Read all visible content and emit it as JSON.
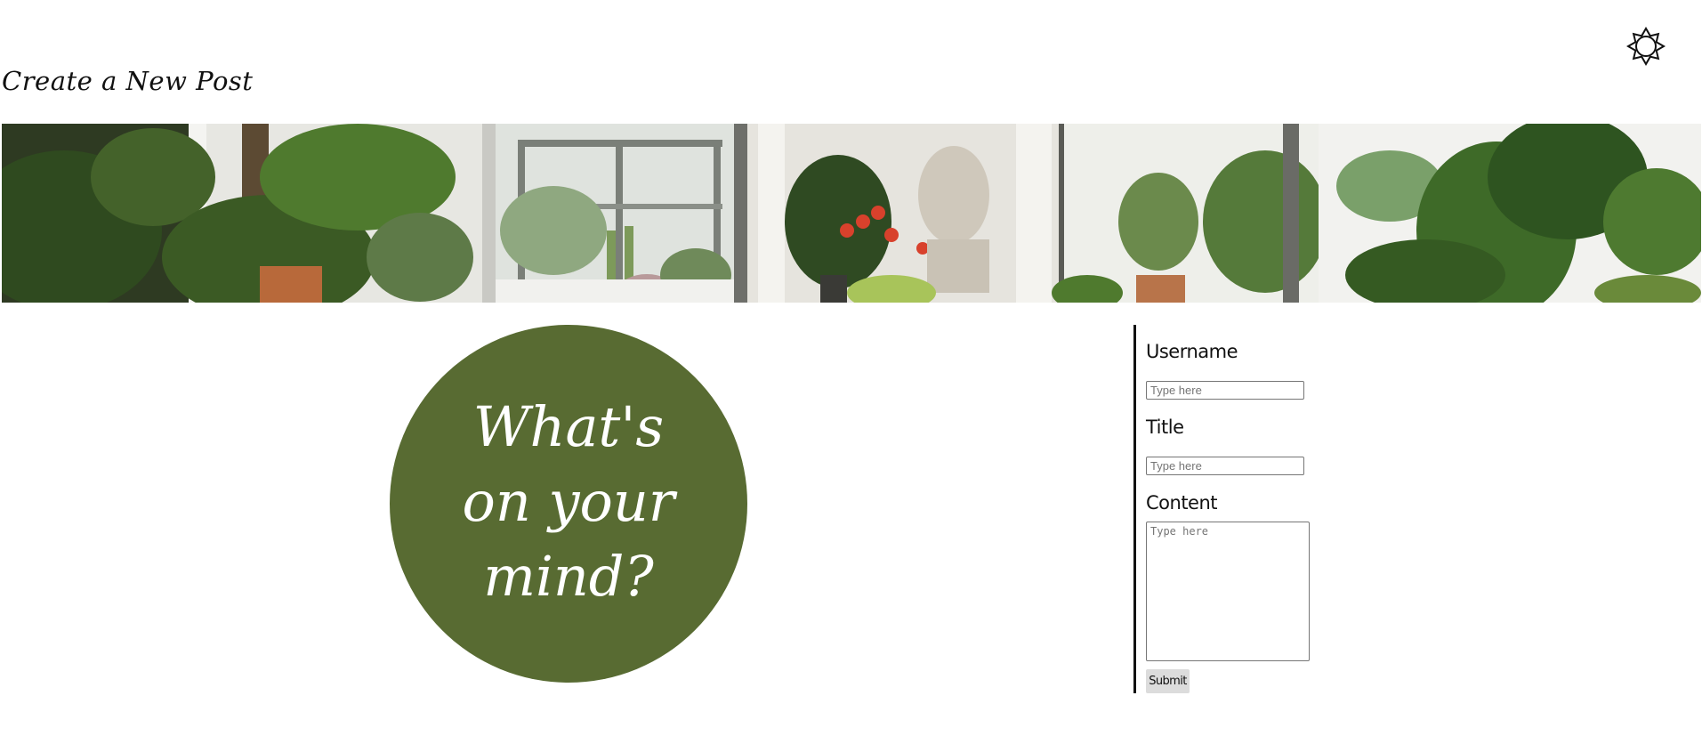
{
  "header": {
    "title": "Create a New Post",
    "theme_toggle_icon": "sun-icon"
  },
  "banner": {
    "image": "houseplants-banner"
  },
  "hero": {
    "line1": "What's",
    "line2": "on your",
    "line3": "mind?",
    "circle_color": "#586b32"
  },
  "form": {
    "username_label": "Username",
    "username_placeholder": "Type here",
    "title_label": "Title",
    "title_placeholder": "Type here",
    "content_label": "Content",
    "content_placeholder": "Type here",
    "submit_label": "Submit"
  }
}
